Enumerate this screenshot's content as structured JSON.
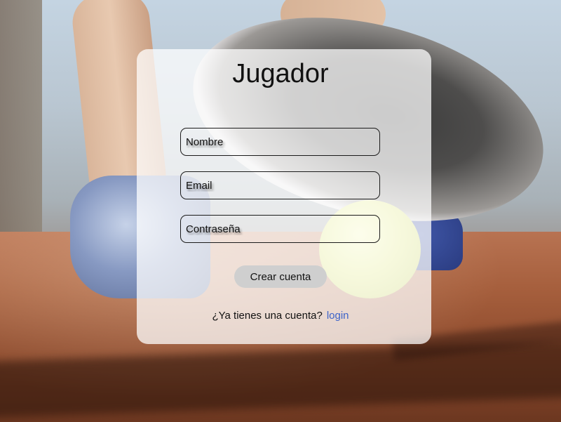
{
  "form": {
    "title": "Jugador",
    "fields": {
      "name_placeholder": "Nombre",
      "email_placeholder": "Email",
      "password_placeholder": "Contraseña"
    },
    "submit_label": "Crear cuenta",
    "footer": {
      "prompt": "¿Ya tienes una cuenta?",
      "login_link": "login"
    }
  },
  "colors": {
    "card_background": "#ffffffbd",
    "button_background": "#cfcfcf",
    "link": "#3d63c9"
  }
}
